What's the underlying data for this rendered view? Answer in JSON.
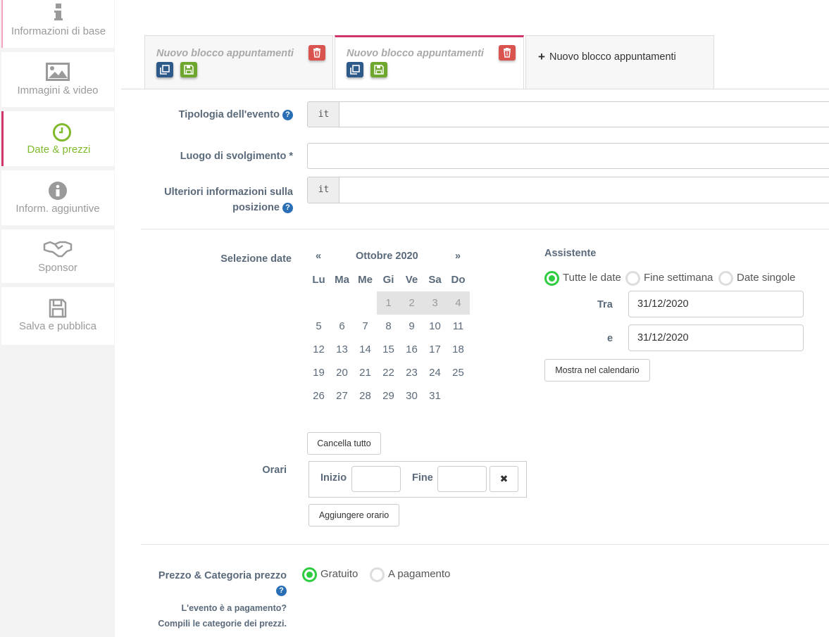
{
  "sidebar": {
    "items": [
      {
        "label": "Informazioni di base",
        "icon": "info-icon"
      },
      {
        "label": "Immagini & video",
        "icon": "image-icon"
      },
      {
        "label": "Date & prezzi",
        "icon": "clock-icon"
      },
      {
        "label": "Inform. aggiuntive",
        "icon": "info-circle-icon"
      },
      {
        "label": "Sponsor",
        "icon": "handshake-icon"
      },
      {
        "label": "Salva e pubblica",
        "icon": "save-icon"
      }
    ]
  },
  "tabs": [
    {
      "title": "Nuovo blocco appuntamenti"
    },
    {
      "title": "Nuovo blocco appuntamenti"
    }
  ],
  "new_tab_label": "Nuovo blocco appuntamenti",
  "form": {
    "tipologia_label": "Tipologia dell'evento",
    "tipologia_lang": "it",
    "luogo_label": "Luogo di svolgimento *",
    "ulteriori_label_1": "Ulteriori informazioni sulla",
    "ulteriori_label_2": "posizione",
    "ulteriori_lang": "it",
    "help_glyph": "?"
  },
  "dates": {
    "label": "Selezione date",
    "prev": "«",
    "next": "»",
    "month": "Ottobre 2020",
    "dow": [
      "Lu",
      "Ma",
      "Me",
      "Gi",
      "Ve",
      "Sa",
      "Do"
    ],
    "weeks": [
      [
        "",
        "",
        "",
        "1",
        "2",
        "3",
        "4"
      ],
      [
        "5",
        "6",
        "7",
        "8",
        "9",
        "10",
        "11"
      ],
      [
        "12",
        "13",
        "14",
        "15",
        "16",
        "17",
        "18"
      ],
      [
        "19",
        "20",
        "21",
        "22",
        "23",
        "24",
        "25"
      ],
      [
        "26",
        "27",
        "28",
        "29",
        "30",
        "31",
        ""
      ]
    ],
    "disabled_days": [
      "1",
      "2",
      "3",
      "4"
    ],
    "clear_all": "Cancella tutto"
  },
  "assistant": {
    "title": "Assistente",
    "options": [
      "Tutte le date",
      "Fine settimana",
      "Date singole"
    ],
    "selected": "Tutte le date",
    "from_label": "Tra",
    "from_value": "31/12/2020",
    "to_label": "e",
    "to_value": "31/12/2020",
    "show_button": "Mostra nel calendario"
  },
  "times": {
    "label": "Orari",
    "start_label": "Inizio",
    "end_label": "Fine",
    "remove_glyph": "✖",
    "add_button": "Aggiungere orario"
  },
  "price": {
    "label": "Prezzo & Categoria prezzo",
    "note_1": "L'evento è a pagamento?",
    "note_2": "Compili le categorie dei prezzi.",
    "options": [
      "Gratuito",
      "A pagamento"
    ],
    "selected": "Gratuito"
  },
  "colors": {
    "accent_pink": "#d2356a",
    "accent_green": "#7fba2c",
    "radio_green": "#2ecc40",
    "help_blue": "#2a6fb5",
    "danger": "#d9534f"
  }
}
